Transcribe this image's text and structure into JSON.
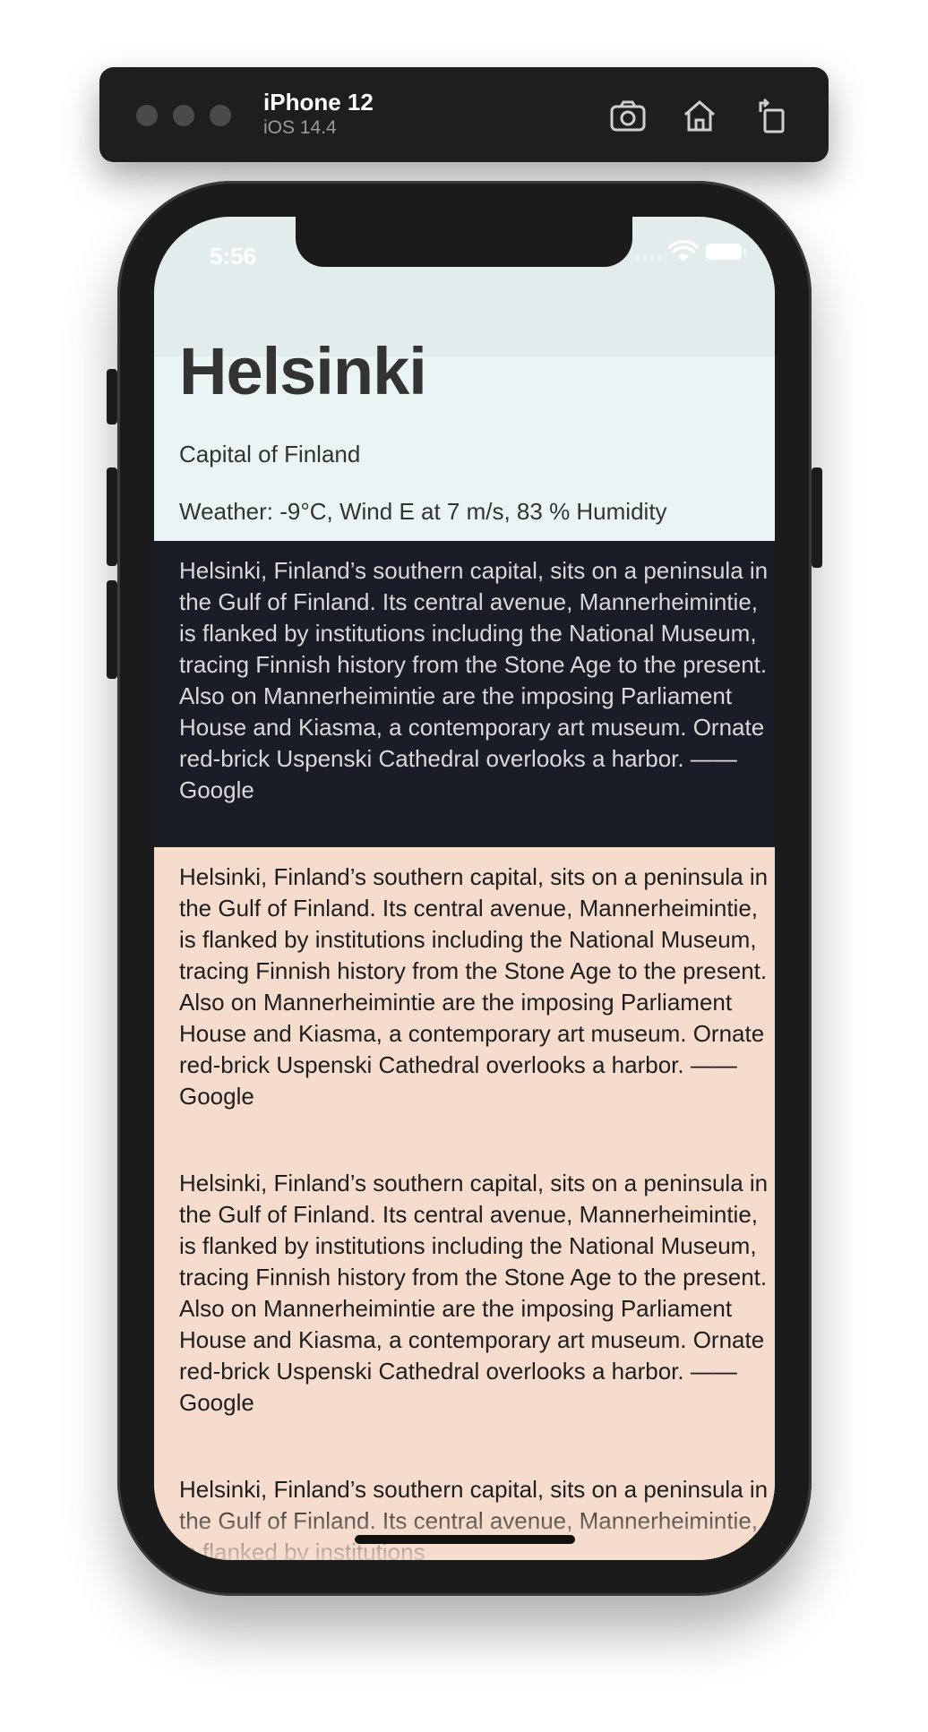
{
  "device": {
    "name": "iPhone 12",
    "os": "iOS 14.4",
    "toolbar_icons": [
      "screenshot-icon",
      "home-icon",
      "rotate-icon"
    ]
  },
  "statusbar": {
    "time": "5:56",
    "icons": [
      "wifi-icon",
      "battery-icon"
    ]
  },
  "app": {
    "title": "Helsinki",
    "subtitle": "Capital of Finland",
    "weather": "Weather: -9°C, Wind E at 7 m/s, 83 % Humidity",
    "paragraphs": [
      "Helsinki, Finland’s southern capital, sits on a peninsula in the Gulf of Finland. Its central avenue, Mannerheimintie, is flanked by institutions including the National Museum, tracing Finnish history from the Stone Age to the present. Also on Mannerheimintie are the imposing Parliament House and Kiasma, a contemporary art museum. Ornate red-brick Uspenski Cathedral overlooks a harbor. —— Google",
      "Helsinki, Finland’s southern capital, sits on a peninsula in the Gulf of Finland. Its central avenue, Mannerheimintie, is flanked by institutions including the National Museum, tracing Finnish history from the Stone Age to the present. Also on Mannerheimintie are the imposing Parliament House and Kiasma, a contemporary art museum. Ornate red-brick Uspenski Cathedral overlooks a harbor. —— Google",
      "Helsinki, Finland’s southern capital, sits on a peninsula in the Gulf of Finland. Its central avenue, Mannerheimintie, is flanked by institutions including the National Museum, tracing Finnish history from the Stone Age to the present. Also on Mannerheimintie are the imposing Parliament House and Kiasma, a contemporary art museum. Ornate red-brick Uspenski Cathedral overlooks a harbor. —— Google",
      "Helsinki, Finland’s southern capital, sits on a peninsula in the Gulf of Finland. Its central avenue, Mannerheimintie, is flanked by institutions"
    ]
  },
  "colors": {
    "header_bg": "#eaf4f4",
    "dark_section_bg": "#1a1c27",
    "peach_section_bg": "#f6dccd"
  }
}
